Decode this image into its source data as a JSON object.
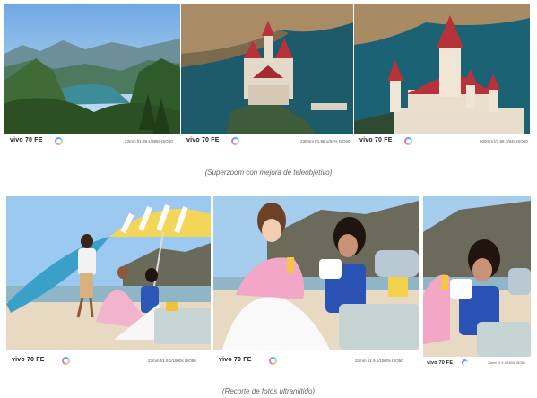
{
  "top_row": {
    "caption": "(Superzoom con mejora de teleobjetivo)",
    "photos": [
      {
        "brand": "vivo 70 FE",
        "meta": "23mm f/1.88 1/985s ISO50"
      },
      {
        "brand": "vivo 70 FE",
        "meta": "230mm f/1.88 1/84% ISO50"
      },
      {
        "brand": "vivo 70 FE",
        "meta": "600mm f/1.88 1/84s ISO50"
      }
    ]
  },
  "bottom_row": {
    "caption": "(Recorte de fotos ultraníitido)",
    "photos": [
      {
        "brand": "vivo 70 FE",
        "meta": "23mm f/1.9 1/1900s ISO50"
      },
      {
        "brand": "vivo 70 FE",
        "meta": "23mm f/1.9 1/1900s ISO50"
      },
      {
        "brand": "vivo 70 FE",
        "meta": "23mm f/1.9 1/1900s ISO50"
      }
    ]
  },
  "colors": {
    "sky": "#9cc9ef",
    "lake": "#1d5a6a",
    "castle_roof": "#b8323a",
    "sand": "#e8d9c2",
    "umbrella_yellow": "#f3d55a"
  }
}
